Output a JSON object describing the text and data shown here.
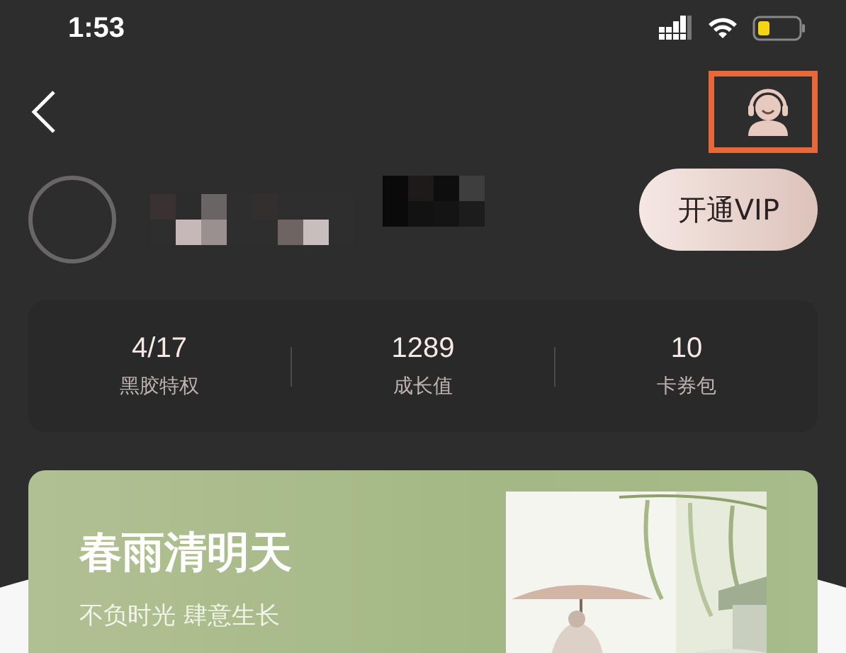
{
  "status_bar": {
    "time": "1:53"
  },
  "header": {
    "highlighted_icon": true
  },
  "profile": {
    "vip_button": "开通VIP"
  },
  "stats": [
    {
      "value": "4/17",
      "label": "黑胶特权"
    },
    {
      "value": "1289",
      "label": "成长值"
    },
    {
      "value": "10",
      "label": "卡券包"
    }
  ],
  "banner": {
    "title": "春雨清明天",
    "subtitle": "不负时光 肆意生长"
  }
}
